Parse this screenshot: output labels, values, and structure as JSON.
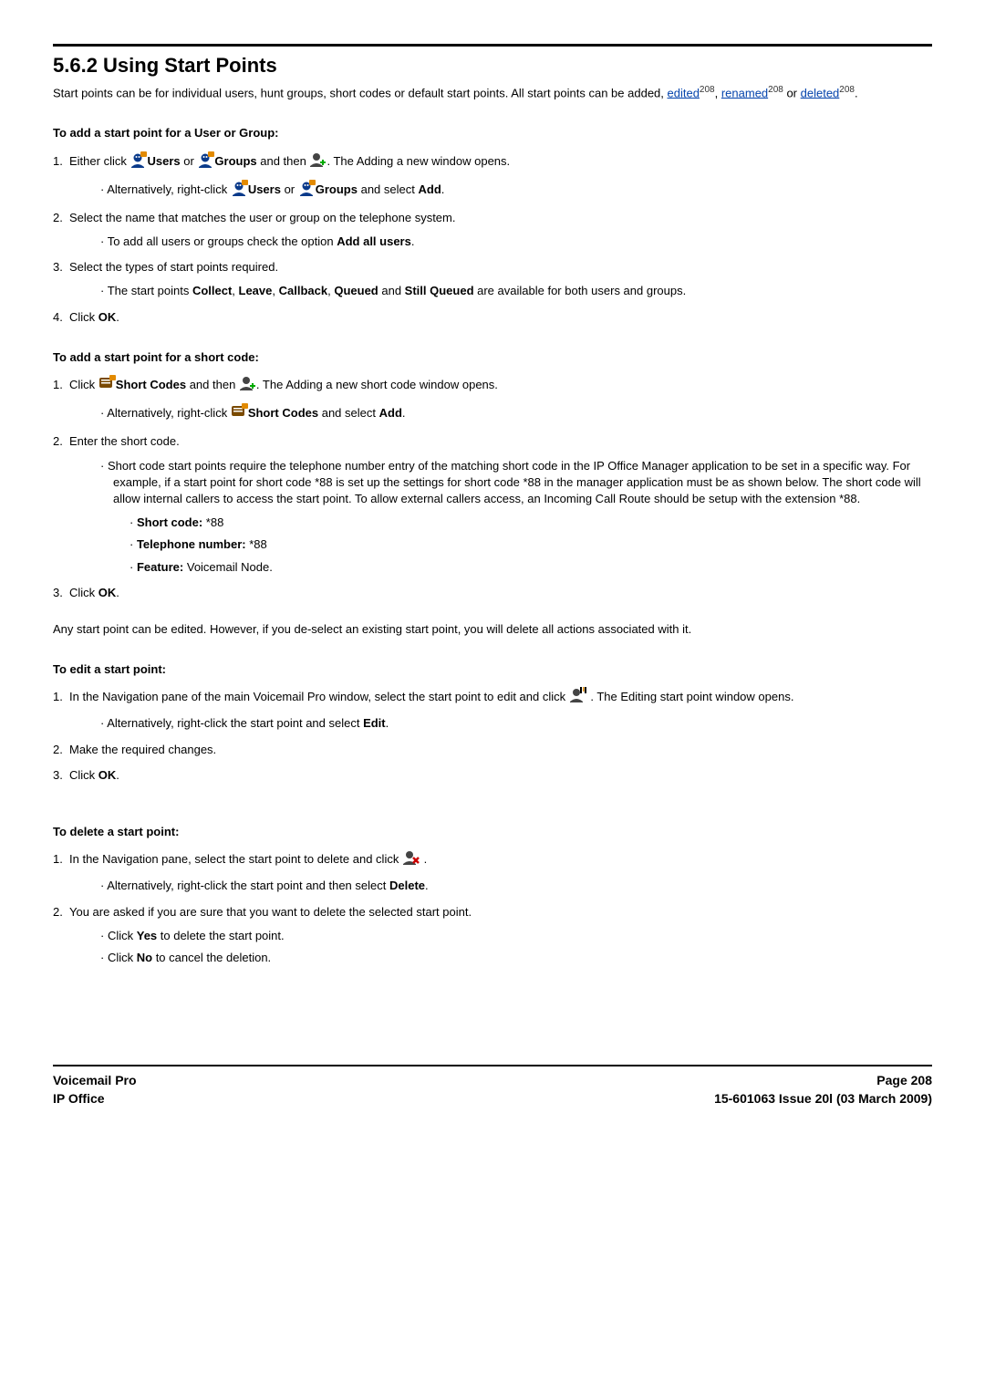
{
  "heading": "5.6.2 Using Start Points",
  "intro_pre": "Start points can be for individual users, hunt groups, short codes or default start points. All start points can be added, ",
  "links": {
    "edited": "edited",
    "renamed": "renamed",
    "deleted": "deleted"
  },
  "ref208": "208",
  "intro_or": " or ",
  "intro_sep": ", ",
  "intro_end": ".",
  "s1": {
    "title": "To add a start point for a User or Group:",
    "li1_a": "Either click ",
    "li1_users": "Users",
    "li1_b": " or ",
    "li1_groups": "Groups",
    "li1_c": " and then ",
    "li1_d": ". The Adding a new window opens.",
    "li1_sub_a": "Alternatively, right-click ",
    "li1_sub_b": " or ",
    "li1_sub_c": " and select ",
    "add": "Add",
    "li1_sub_d": ".",
    "li2": "Select the name that matches the user or group on the telephone system.",
    "li2_sub_a": "To add all users or groups check the option ",
    "li2_sub_b": "Add all users",
    "li2_sub_c": ".",
    "li3": "Select the types of start points required.",
    "li3_sub_a": "The start points ",
    "li3_sub_collect": "Collect",
    "li3_sub_leave": "Leave",
    "li3_sub_callback": "Callback",
    "li3_sub_queued": "Queued",
    "li3_sub_and": " and ",
    "li3_sub_still": "Still Queued",
    "li3_sub_b": " are available for both users and groups.",
    "li4_a": "Click ",
    "ok": "OK",
    "li4_b": "."
  },
  "s2": {
    "title": "To add a start point for a short code:",
    "li1_a": "Click ",
    "short_codes": "Short Codes",
    "li1_b": " and then ",
    "li1_c": ". The Adding a new short code window opens.",
    "li1_sub_a": "Alternatively, right-click ",
    "li1_sub_b": " and select ",
    "li1_sub_c": ".",
    "li2": "Enter the short code.",
    "li2_sub_para": "Short code start points require the telephone number entry of the matching short code in the IP Office Manager application to be set in a specific way. For example, if a start point for short code *88 is set up the settings for short code *88 in the manager application must be as shown below. The short code will allow internal callers to access the start point. To allow external callers access, an Incoming Call Route should be setup with the extension *88.",
    "sc_label": "Short code:",
    "sc_val": " *88",
    "tn_label": "Telephone number:",
    "tn_val": " *88",
    "ft_label": "Feature:",
    "ft_val": " Voicemail Node.",
    "li3_a": "Click ",
    "li3_b": "."
  },
  "edit_para": "Any start point can be edited. However, if you de-select an existing start point, you will delete all actions associated with it.",
  "s3": {
    "title": "To edit a start point:",
    "li1_a": "In the Navigation pane of the main Voicemail Pro window, select the start point to edit and click ",
    "li1_b": " . The Editing start point window opens.",
    "li1_sub_a": "Alternatively, right-click the start point and select ",
    "edit": "Edit",
    "li1_sub_b": ".",
    "li2": "Make the required changes.",
    "li3_a": "Click ",
    "li3_b": "."
  },
  "s4": {
    "title": "To delete a start point:",
    "li1_a": "In the Navigation pane, select the start point to delete and click ",
    "li1_b": " .",
    "li1_sub_a": "Alternatively, right-click the start point and then select ",
    "delete": "Delete",
    "li1_sub_b": ".",
    "li2": "You are asked if you are sure that you want to delete the selected start point.",
    "li2_sub1_a": "Click ",
    "yes": "Yes",
    "li2_sub1_b": " to delete the start point.",
    "li2_sub2_a": "Click ",
    "no": "No",
    "li2_sub2_b": " to cancel the deletion."
  },
  "footer": {
    "left1": "Voicemail Pro",
    "left2": "IP Office",
    "right1": "Page 208",
    "right2": "15-601063 Issue 20l (03 March 2009)"
  }
}
